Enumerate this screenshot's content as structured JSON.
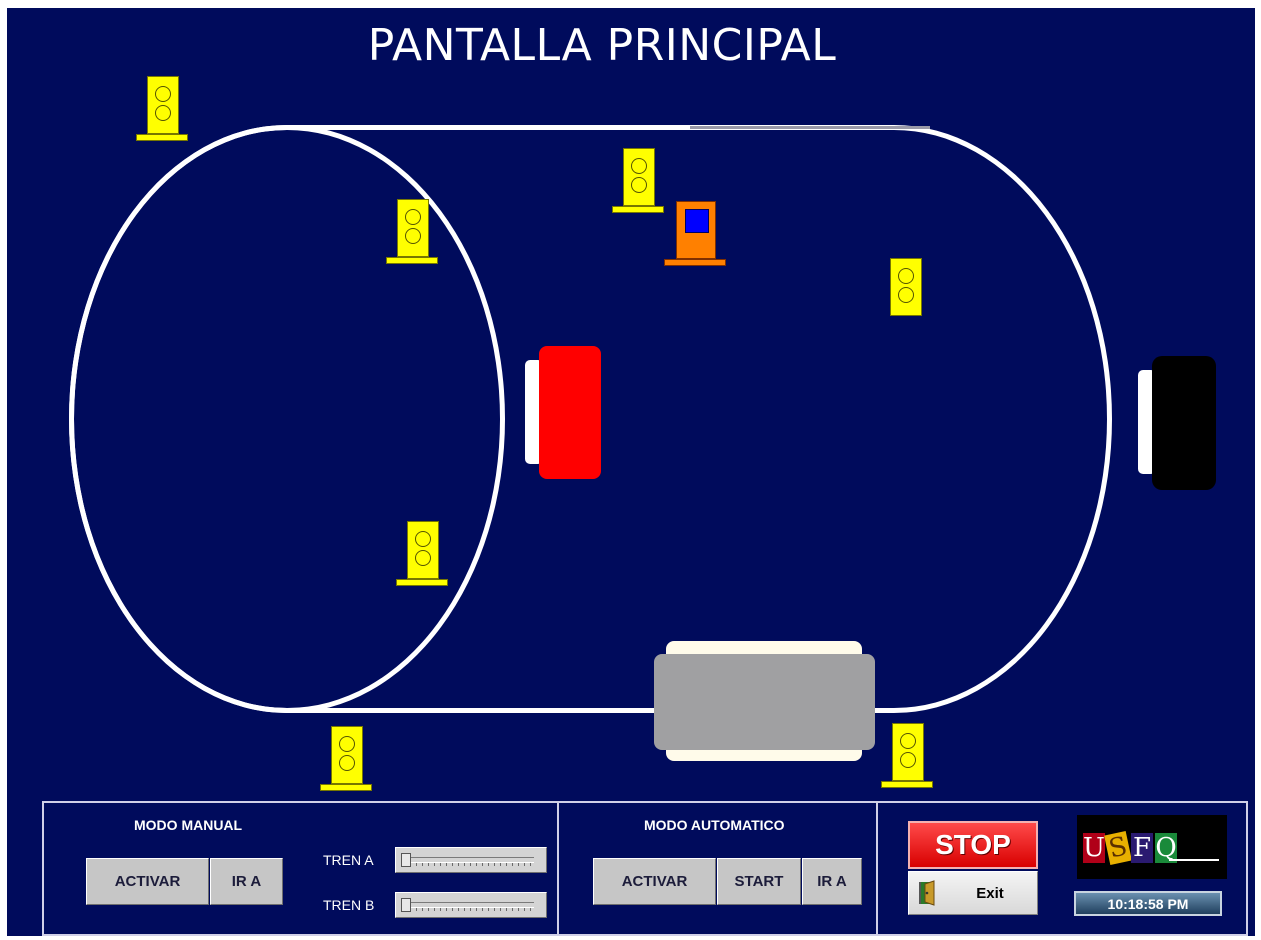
{
  "title": "PANTALLA PRINCIPAL",
  "colors": {
    "background": "#000b5c",
    "track": "#ffffff",
    "signal": "#ffff00",
    "train_red": "#ff0000",
    "train_black": "#000000",
    "train_gray": "#a0a0a2",
    "station_orange": "#ff8000",
    "station_window": "#0000ff"
  },
  "manual": {
    "label": "MODO MANUAL",
    "activar": "ACTIVAR",
    "ir_a": "IR A",
    "tren_a_label": "TREN A",
    "tren_b_label": "TREN B",
    "tren_a_value": 0,
    "tren_b_value": 0
  },
  "auto": {
    "label": "MODO AUTOMATICO",
    "activar": "ACTIVAR",
    "start": "START",
    "ir_a": "IR A"
  },
  "controls": {
    "stop": "STOP",
    "exit": "Exit",
    "exit_icon": "door-exit-icon"
  },
  "logo": {
    "letters": [
      "U",
      "S",
      "F",
      "Q"
    ]
  },
  "clock": "10:18:58 PM"
}
